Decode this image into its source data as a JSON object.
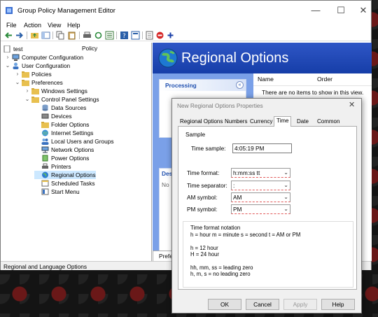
{
  "window": {
    "title": "Group Policy Management Editor"
  },
  "menu": [
    "File",
    "Action",
    "View",
    "Help"
  ],
  "tree": {
    "policy_label": "Policy",
    "items": [
      {
        "label": "test"
      },
      {
        "label": "Computer Configuration"
      },
      {
        "label": "User Configuration"
      },
      {
        "label": "Policies"
      },
      {
        "label": "Preferences"
      },
      {
        "label": "Windows Settings"
      },
      {
        "label": "Control Panel Settings"
      },
      {
        "label": "Data Sources"
      },
      {
        "label": "Devices"
      },
      {
        "label": "Folder Options"
      },
      {
        "label": "Internet Settings"
      },
      {
        "label": "Local Users and Groups"
      },
      {
        "label": "Network Options"
      },
      {
        "label": "Power Options"
      },
      {
        "label": "Printers"
      },
      {
        "label": "Regional Options"
      },
      {
        "label": "Scheduled Tasks"
      },
      {
        "label": "Start Menu"
      }
    ]
  },
  "right": {
    "banner_title": "Regional Options",
    "processing_label": "Processing",
    "description_label": "Des",
    "description_text": "No",
    "columns": [
      "Name",
      "Order"
    ],
    "empty_message": "There are no items to show in this view.",
    "bottom_tab": "Prefer"
  },
  "status": {
    "text": "Regional and Language Options"
  },
  "dialog": {
    "title": "New Regional Options Properties",
    "tabs": [
      "Regional Options",
      "Numbers",
      "Currency",
      "Time",
      "Date",
      "Common"
    ],
    "active_tab": "Time",
    "sample_label": "Sample",
    "time_sample_label": "Time sample:",
    "time_sample_value": "4:05:19 PM",
    "time_format_label": "Time format:",
    "time_format_value": "h:mm:ss tt",
    "time_separator_label": "Time separator:",
    "time_separator_value": ":",
    "am_symbol_label": "AM symbol:",
    "am_symbol_value": "AM",
    "pm_symbol_label": "PM symbol:",
    "pm_symbol_value": "PM",
    "notation": [
      "Time format notation",
      "h = hour    m = minute    s = second    t = AM or PM",
      "",
      "h = 12 hour",
      "H = 24 hour",
      "",
      "hh, mm, ss = leading zero",
      "h, m, s = no leading zero"
    ],
    "buttons": {
      "ok": "OK",
      "cancel": "Cancel",
      "apply": "Apply",
      "help": "Help"
    }
  },
  "colors": {
    "banner": "#1f47b8",
    "side_panel": "#7aa0e8",
    "selection": "#cce8ff",
    "combo_underline": "#e15a5a"
  }
}
